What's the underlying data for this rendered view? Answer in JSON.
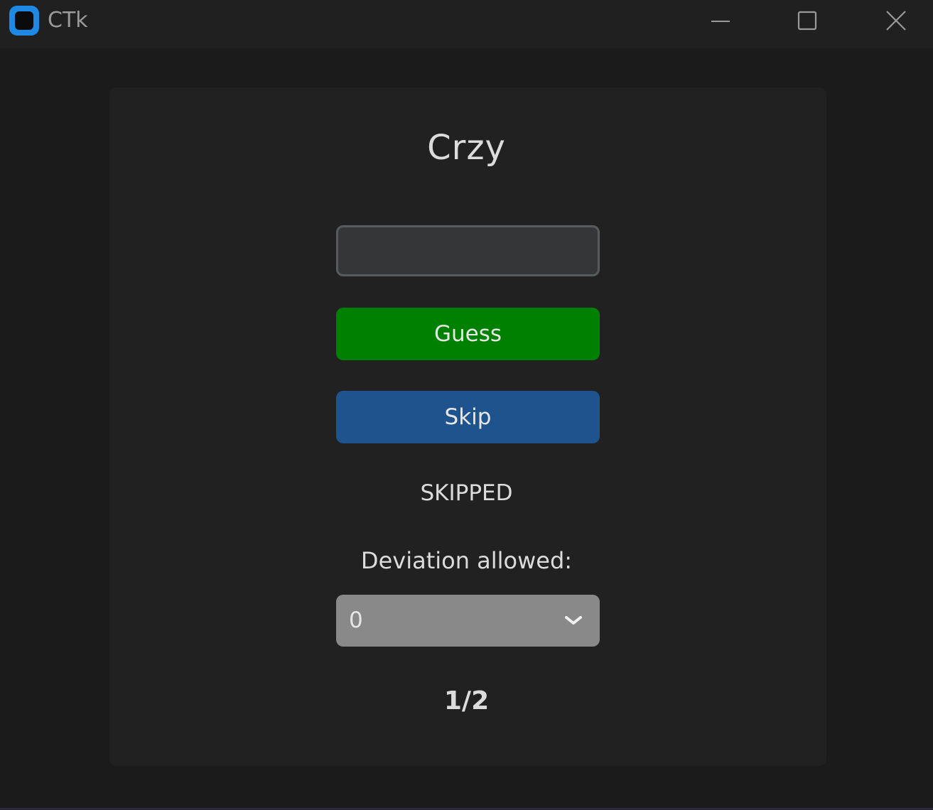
{
  "window": {
    "title": "CTk",
    "controls": {
      "minimize_icon": "minimize-icon",
      "maximize_icon": "maximize-icon",
      "close_icon": "close-icon"
    }
  },
  "game": {
    "heading": "Crzy",
    "guess_input": {
      "value": "",
      "placeholder": ""
    },
    "guess_button_label": "Guess",
    "skip_button_label": "Skip",
    "status_text": "SKIPPED",
    "deviation_label": "Deviation allowed:",
    "deviation_selected": "0",
    "progress_text": "1/2"
  },
  "colors": {
    "guess_button": "#008000",
    "skip_button": "#1f538d",
    "dropdown": "#898989",
    "card": "#212121",
    "background": "#1b1b1b"
  }
}
